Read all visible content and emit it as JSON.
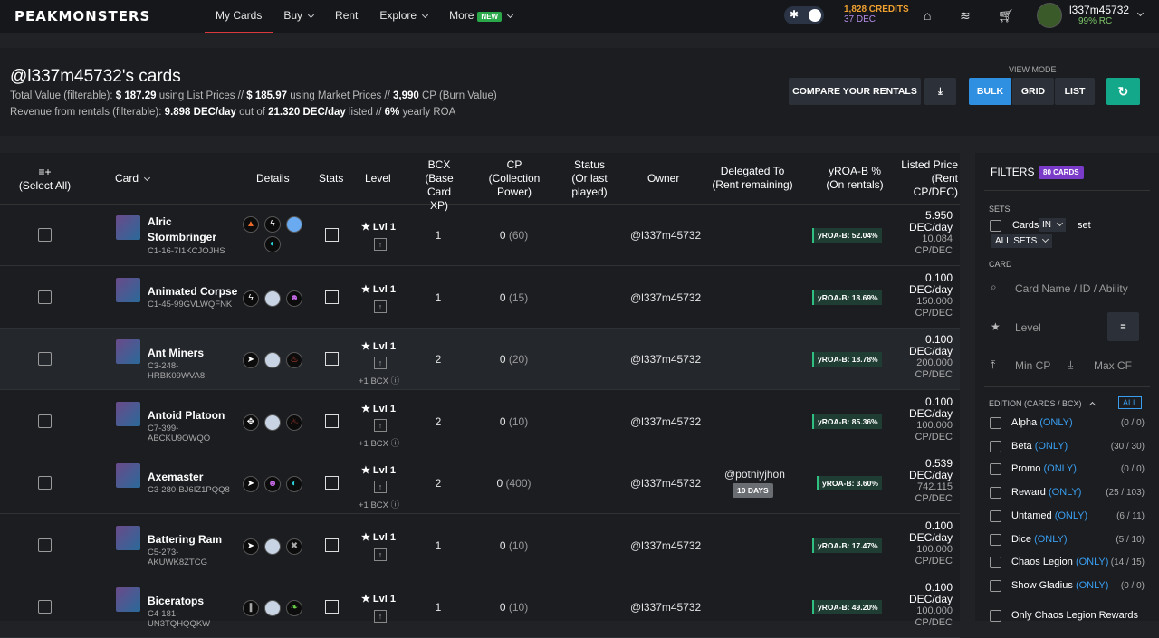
{
  "topbar": {
    "logo": "PEAKMONSTERS",
    "nav": [
      "My Cards",
      "Buy",
      "Rent",
      "Explore",
      "More"
    ],
    "new_badge": "NEW",
    "credits": "1,828 CREDITS",
    "dec": "37 DEC",
    "username": "l337m45732",
    "rc": "99% RC"
  },
  "header": {
    "title": "@l337m45732's cards",
    "line1_a": "Total Value (filterable):",
    "v1": "$ 187.29",
    "line1_b": "using List Prices //",
    "v2": "$ 185.97",
    "line1_c": "using Market Prices //",
    "v3": "3,990",
    "line1_d": "CP (Burn Value)",
    "line2_a": "Revenue from rentals (filterable):",
    "r1": "9.898 DEC/day",
    "line2_b": "out of",
    "r2": "21.320 DEC/day",
    "line2_c": "listed //",
    "r3": "6%",
    "line2_d": "yearly ROA",
    "compare": "COMPARE YOUR RENTALS",
    "view_mode": "VIEW MODE",
    "bulk": "BULK",
    "grid": "GRID",
    "list": "LIST"
  },
  "columns": {
    "select": "≡+",
    "select2": "(Select All)",
    "card": "Card",
    "details": "Details",
    "stats": "Stats",
    "level": "Level",
    "bcx1": "BCX",
    "bcx2": "(Base Card",
    "bcx3": "XP)",
    "cp1": "CP",
    "cp2": "(Collection",
    "cp3": "Power)",
    "st1": "Status",
    "st2": "(Or last",
    "st3": "played)",
    "owner": "Owner",
    "del1": "Delegated To",
    "del2": "(Rent remaining)",
    "y1": "yROA-B %",
    "y2": "(On rentals)",
    "lp1": "Listed Price",
    "lp2": "(Rent",
    "lp3": "CP/DEC)"
  },
  "rows": [
    {
      "name1": "Alric",
      "name2": "Stormbringer",
      "id": "C1-16-7I1KCJOJHS",
      "level": "Lvl 1",
      "pbcx": "",
      "bcx": "1",
      "cp": "0",
      "cpm": "(60)",
      "owner": "@l337m45732",
      "deleg": "",
      "days": "",
      "yroa": "yROA-B: 52.04%",
      "p1": "5.950",
      "p2": "DEC/day",
      "p3": "10.084",
      "p4": "CP/DEC"
    },
    {
      "name1": "Animated Corpse",
      "name2": "",
      "id": "C1-45-99GVLWQFNK",
      "level": "Lvl 1",
      "pbcx": "",
      "bcx": "1",
      "cp": "0",
      "cpm": "(15)",
      "owner": "@l337m45732",
      "deleg": "",
      "days": "",
      "yroa": "yROA-B: 18.69%",
      "p1": "0.100",
      "p2": "DEC/day",
      "p3": "150.000",
      "p4": "CP/DEC"
    },
    {
      "name1": "Ant Miners",
      "name2": "",
      "id": "C3-248-",
      "id2": "HRBK09WVA8",
      "level": "Lvl 1",
      "pbcx": "+1 BCX",
      "bcx": "2",
      "cp": "0",
      "cpm": "(20)",
      "owner": "@l337m45732",
      "deleg": "",
      "days": "",
      "yroa": "yROA-B: 18.78%",
      "p1": "0.100",
      "p2": "DEC/day",
      "p3": "200.000",
      "p4": "CP/DEC"
    },
    {
      "name1": "Antoid Platoon",
      "name2": "",
      "id": "C7-399-",
      "id2": "ABCKU9OWQO",
      "level": "Lvl 1",
      "pbcx": "+1 BCX",
      "bcx": "2",
      "cp": "0",
      "cpm": "(10)",
      "owner": "@l337m45732",
      "deleg": "",
      "days": "",
      "yroa": "yROA-B: 85.36%",
      "p1": "0.100",
      "p2": "DEC/day",
      "p3": "100.000",
      "p4": "CP/DEC"
    },
    {
      "name1": "Axemaster",
      "name2": "",
      "id": "C3-280-BJ6IZ1PQQ8",
      "level": "Lvl 1",
      "pbcx": "+1 BCX",
      "bcx": "2",
      "cp": "0",
      "cpm": "(400)",
      "owner": "@l337m45732",
      "deleg": "@potniyjhon",
      "days": "10 DAYS",
      "yroa": "yROA-B: 3.60%",
      "p1": "0.539",
      "p2": "DEC/day",
      "p3": "742.115",
      "p4": "CP/DEC"
    },
    {
      "name1": "Battering Ram",
      "name2": "",
      "id": "C5-273-",
      "id2": "AKUWK8ZTCG",
      "level": "Lvl 1",
      "pbcx": "",
      "bcx": "1",
      "cp": "0",
      "cpm": "(10)",
      "owner": "@l337m45732",
      "deleg": "",
      "days": "",
      "yroa": "yROA-B: 17.47%",
      "p1": "0.100",
      "p2": "DEC/day",
      "p3": "100.000",
      "p4": "CP/DEC"
    },
    {
      "name1": "Biceratops",
      "name2": "",
      "id": "C4-181-",
      "id2": "UN3TQHQQKW",
      "level": "Lvl 1",
      "pbcx": "",
      "bcx": "1",
      "cp": "0",
      "cpm": "(10)",
      "owner": "@l337m45732",
      "deleg": "",
      "days": "",
      "yroa": "yROA-B: 49.20%",
      "p1": "0.100",
      "p2": "DEC/day",
      "p3": "100.000",
      "p4": "CP/DEC"
    }
  ],
  "filters": {
    "title": "FILTERS",
    "count": "80 CARDS",
    "sets": "SETS",
    "cards": "Cards",
    "in": "IN",
    "set": "set",
    "all_sets": "ALL SETS",
    "card": "CARD",
    "card_ph": "Card Name / ID / Ability",
    "level": "Level",
    "eq": "=",
    "min_cp": "Min CP",
    "max_cp": "Max CF",
    "edition": "EDITION (CARDS / BCX)",
    "all": "ALL",
    "only": "(ONLY)",
    "editions": [
      {
        "n": "Alpha",
        "c": "(0 / 0)"
      },
      {
        "n": "Beta",
        "c": "(30 / 30)"
      },
      {
        "n": "Promo",
        "c": "(0 / 0)"
      },
      {
        "n": "Reward",
        "c": "(25 / 103)"
      },
      {
        "n": "Untamed",
        "c": "(6 / 11)"
      },
      {
        "n": "Dice",
        "c": "(5 / 10)"
      },
      {
        "n": "Chaos Legion",
        "c": "(14 / 15)"
      },
      {
        "n": "Show Gladius",
        "c": "(0 / 0)"
      }
    ],
    "only_cl": "Only Chaos Legion Rewards"
  }
}
